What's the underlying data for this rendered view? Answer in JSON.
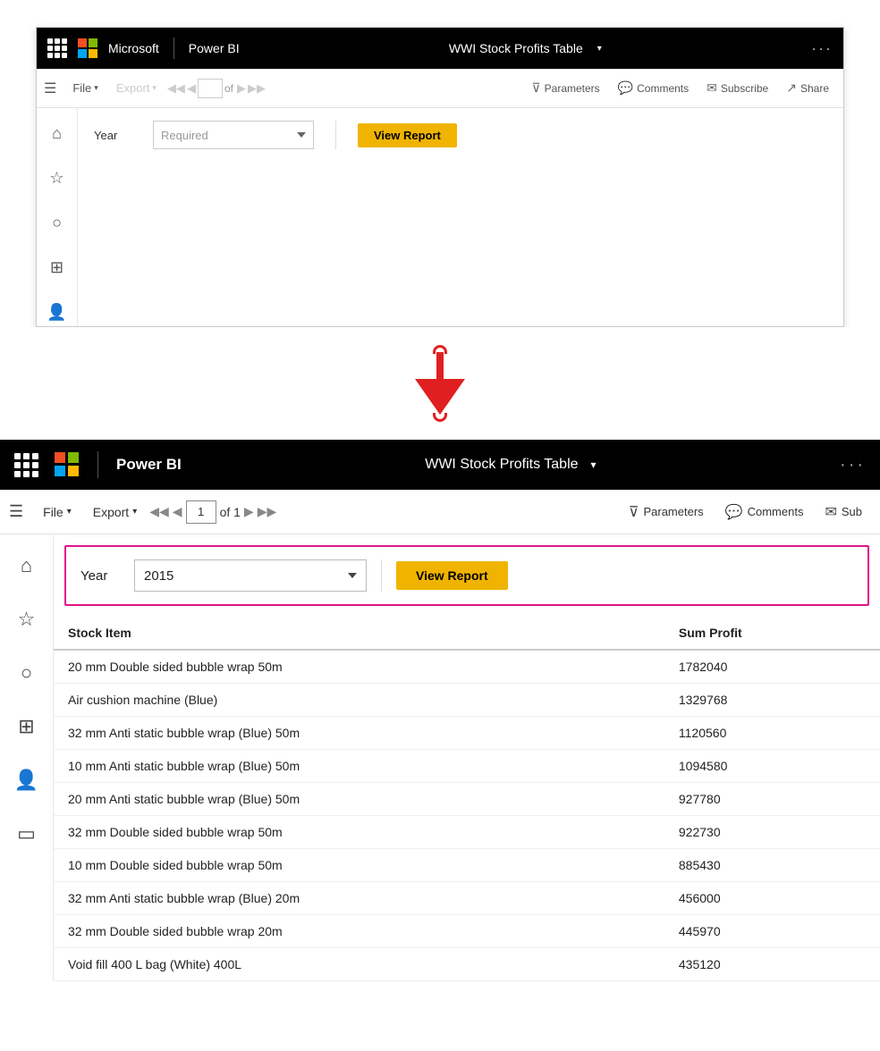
{
  "top": {
    "nav": {
      "app_name": "Microsoft",
      "product": "Power BI",
      "report_name": "WWI Stock Profits Table",
      "more": "···"
    },
    "toolbar": {
      "file_label": "File",
      "export_label": "Export",
      "page_num": "",
      "of_text": "of",
      "page_count": "",
      "parameters_label": "Parameters",
      "comments_label": "Comments",
      "subscribe_label": "Subscribe",
      "share_label": "Share"
    },
    "params": {
      "year_label": "Year",
      "year_placeholder": "Required",
      "view_report_label": "View Report"
    }
  },
  "arrow": {
    "direction": "down"
  },
  "bottom": {
    "nav": {
      "app_name": "Microsoft",
      "product": "Power BI",
      "report_name": "WWI Stock Profits Table",
      "more": "···"
    },
    "toolbar": {
      "file_label": "File",
      "export_label": "Export",
      "page_num": "1",
      "of_label": "of 1",
      "parameters_label": "Parameters",
      "comments_label": "Comments",
      "subscribe_label": "Sub"
    },
    "params": {
      "year_label": "Year",
      "year_value": "2015",
      "view_report_label": "View Report"
    },
    "table": {
      "col1_header": "Stock Item",
      "col2_header": "Sum Profit",
      "rows": [
        {
          "item": "20 mm Double sided bubble wrap 50m",
          "profit": "1782040"
        },
        {
          "item": "Air cushion machine (Blue)",
          "profit": "1329768"
        },
        {
          "item": "32 mm Anti static bubble wrap (Blue) 50m",
          "profit": "1120560"
        },
        {
          "item": "10 mm Anti static bubble wrap (Blue) 50m",
          "profit": "1094580"
        },
        {
          "item": "20 mm Anti static bubble wrap (Blue) 50m",
          "profit": "927780"
        },
        {
          "item": "32 mm Double sided bubble wrap 50m",
          "profit": "922730"
        },
        {
          "item": "10 mm Double sided bubble wrap 50m",
          "profit": "885430"
        },
        {
          "item": "32 mm Anti static bubble wrap (Blue) 20m",
          "profit": "456000"
        },
        {
          "item": "32 mm Double sided bubble wrap 20m",
          "profit": "445970"
        },
        {
          "item": "Void fill 400 L bag (White) 400L",
          "profit": "435120"
        }
      ]
    }
  },
  "icons": {
    "menu": "☰",
    "home": "⌂",
    "star": "☆",
    "clock": "○",
    "apps": "⊞",
    "people": "👤",
    "monitor": "▭",
    "filter": "⊽",
    "comment": "▭",
    "envelope": "✉",
    "share": "↗",
    "nav_first": "◀◀",
    "nav_prev": "◀",
    "nav_next": "▶",
    "nav_last": "▶▶",
    "chevron_down": "▾"
  },
  "colors": {
    "black_nav": "#000000",
    "yellow_btn": "#f0b400",
    "pink_border": "#e0148a",
    "text_dark": "#222222",
    "text_muted": "#999999"
  }
}
